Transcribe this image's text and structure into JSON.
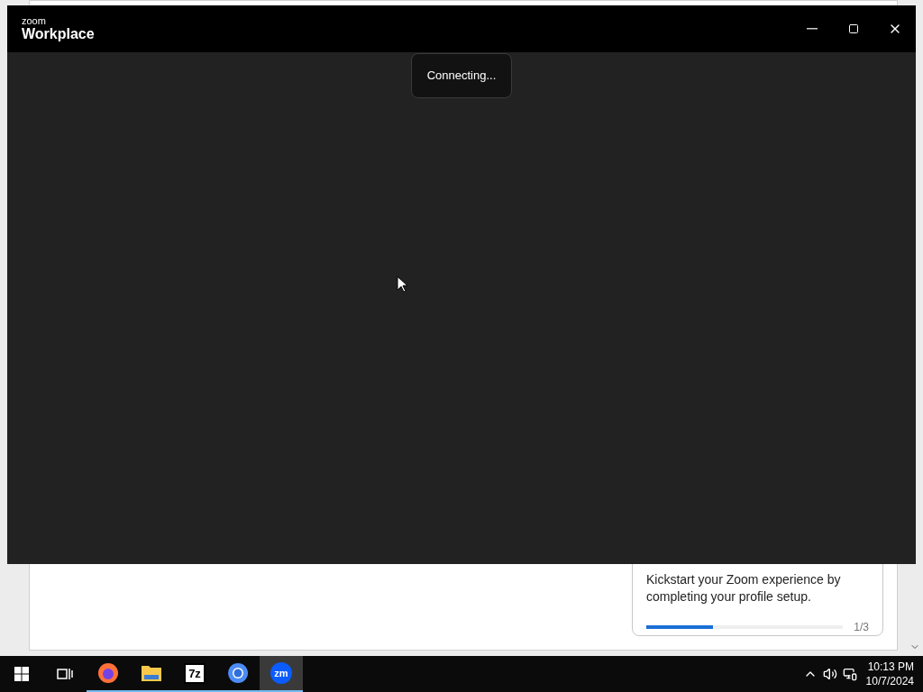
{
  "background_app": {
    "card": {
      "text": "Kickstart your Zoom experience by completing your profile setup.",
      "level": 0.34,
      "step": "1/3"
    }
  },
  "window": {
    "brand": "zoom",
    "title": "Workplace",
    "toast": "Connecting..."
  },
  "taskbar": {
    "apps": [
      {
        "kind": "firefox",
        "running": true,
        "selected": false
      },
      {
        "kind": "folder",
        "running": true,
        "selected": false
      },
      {
        "kind": "sevenzip",
        "label": "7z",
        "running": true,
        "selected": false
      },
      {
        "kind": "chrome",
        "running": true,
        "selected": false
      },
      {
        "kind": "zoom",
        "label": "zm",
        "running": true,
        "selected": true
      }
    ],
    "time": "10:13 PM",
    "date": "10/7/2024"
  }
}
